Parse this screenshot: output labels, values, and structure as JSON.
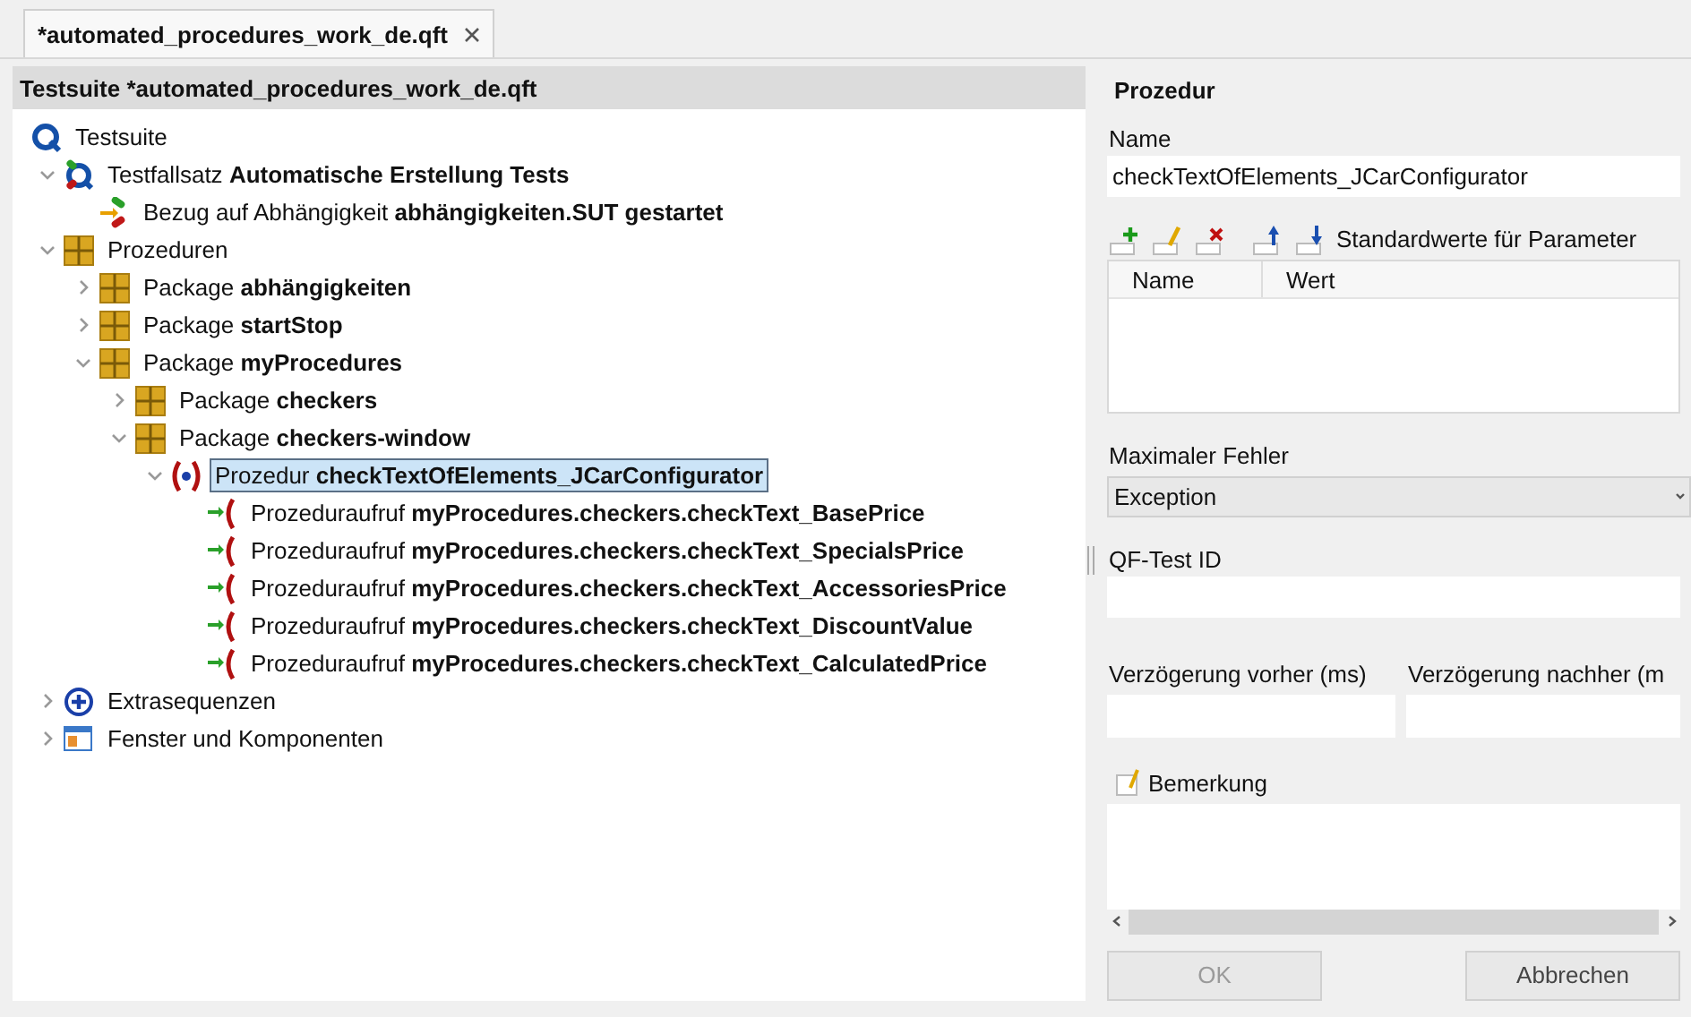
{
  "tab": {
    "title": "*automated_procedures_work_de.qft"
  },
  "tree_panel": {
    "title": "Testsuite *automated_procedures_work_de.qft",
    "nodes": [
      {
        "kind": "suite",
        "prefix": "Testsuite",
        "selected": false,
        "children": [
          {
            "kind": "testset",
            "prefix": "Testfallsatz",
            "name": "Automatische Erstellung Tests",
            "selected": false,
            "expanded": true,
            "children": [
              {
                "kind": "reference",
                "prefix": "Bezug auf Abhängigkeit",
                "name": "abhängigkeiten.SUT gestartet",
                "selected": false
              }
            ]
          },
          {
            "kind": "package",
            "prefix": "Prozeduren",
            "selected": false,
            "expanded": true,
            "children": [
              {
                "kind": "package",
                "prefix": "Package",
                "name": "abhängigkeiten",
                "selected": false,
                "expanded": false
              },
              {
                "kind": "package",
                "prefix": "Package",
                "name": "startStop",
                "selected": false,
                "expanded": false
              },
              {
                "kind": "package",
                "prefix": "Package",
                "name": "myProcedures",
                "selected": false,
                "expanded": true,
                "children": [
                  {
                    "kind": "package",
                    "prefix": "Package",
                    "name": "checkers",
                    "selected": false,
                    "expanded": false
                  },
                  {
                    "kind": "package",
                    "prefix": "Package",
                    "name": "checkers-window",
                    "selected": false,
                    "expanded": true,
                    "children": [
                      {
                        "kind": "procedure",
                        "prefix": "Prozedur",
                        "name": "checkTextOfElements_JCarConfigurator",
                        "selected": true,
                        "expanded": true,
                        "children": [
                          {
                            "kind": "call",
                            "prefix": "Prozeduraufruf",
                            "name": "myProcedures.checkers.checkText_BasePrice",
                            "selected": false
                          },
                          {
                            "kind": "call",
                            "prefix": "Prozeduraufruf",
                            "name": "myProcedures.checkers.checkText_SpecialsPrice",
                            "selected": false
                          },
                          {
                            "kind": "call",
                            "prefix": "Prozeduraufruf",
                            "name": "myProcedures.checkers.checkText_AccessoriesPrice",
                            "selected": false
                          },
                          {
                            "kind": "call",
                            "prefix": "Prozeduraufruf",
                            "name": "myProcedures.checkers.checkText_DiscountValue",
                            "selected": false
                          },
                          {
                            "kind": "call",
                            "prefix": "Prozeduraufruf",
                            "name": "myProcedures.checkers.checkText_CalculatedPrice",
                            "selected": false
                          }
                        ]
                      }
                    ]
                  }
                ]
              }
            ]
          },
          {
            "kind": "extras",
            "prefix": "Extrasequenzen",
            "selected": false,
            "expanded": false
          },
          {
            "kind": "windows",
            "prefix": "Fenster und Komponenten",
            "selected": false,
            "expanded": false
          }
        ]
      }
    ]
  },
  "detail": {
    "title": "Prozedur",
    "name_label": "Name",
    "name_value": "checkTextOfElements_JCarConfigurator",
    "toolbar": [
      {
        "kind": "add"
      },
      {
        "kind": "edit"
      },
      {
        "kind": "delete"
      },
      {
        "kind": "up"
      },
      {
        "kind": "down"
      }
    ],
    "params_label": "Standardwerte für Parameter",
    "param_columns": [
      "Name",
      "Wert"
    ],
    "max_error_label": "Maximaler Fehler",
    "max_error_value": "Exception",
    "id_label": "QF-Test ID",
    "delay_before_label": "Verzögerung vorher (ms)",
    "delay_after_label": "Verzögerung nachher (m",
    "comment_label": "Bemerkung",
    "buttons": [
      {
        "label": "OK",
        "disabled": true
      },
      {
        "label": "Abbrechen",
        "disabled": false
      }
    ]
  }
}
